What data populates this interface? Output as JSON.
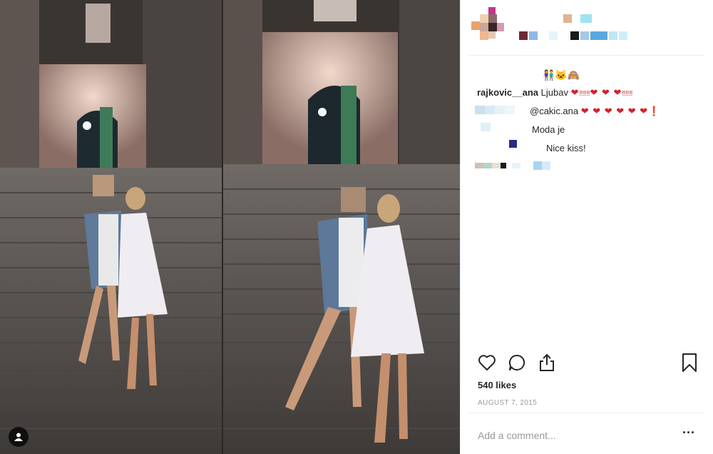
{
  "caption": {
    "emoji": "👫🐱🙈",
    "username": "rajkovic__ana",
    "text": "Ljubav",
    "hearts_a": "❤",
    "bangs_a": "‼‼‼",
    "hearts_b": "❤ ❤ ❤",
    "bangs_b": "‼‼‼"
  },
  "comments": [
    {
      "text": "@cakic.ana",
      "hearts": "❤ ❤ ❤ ❤ ❤ ❤",
      "tail": "❗"
    },
    {
      "text": "Moda je"
    },
    {
      "text": "Nice kiss!"
    }
  ],
  "likes": "540 likes",
  "date": "AUGUST 7, 2015",
  "add_comment_placeholder": "Add a comment...",
  "more_label": "···",
  "icons": {
    "like": "heart-outline-icon",
    "comment": "speech-bubble-icon",
    "share": "share-upload-icon",
    "save": "bookmark-icon",
    "tag": "user-tag-icon"
  }
}
